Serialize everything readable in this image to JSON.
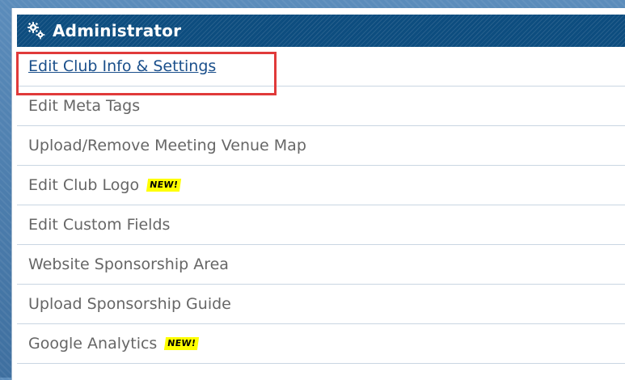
{
  "panel": {
    "title": "Administrator",
    "icon": "gears-icon"
  },
  "menu": {
    "items": [
      {
        "label": "Edit Club Info & Settings",
        "active": true
      },
      {
        "label": "Edit Meta Tags"
      },
      {
        "label": "Upload/Remove Meeting Venue Map"
      },
      {
        "label": "Edit Club Logo",
        "badge": "NEW!"
      },
      {
        "label": "Edit Custom Fields"
      },
      {
        "label": "Website Sponsorship Area"
      },
      {
        "label": "Upload Sponsorship Guide"
      },
      {
        "label": "Google Analytics",
        "badge": "NEW!"
      }
    ]
  },
  "colors": {
    "header_bg": "#0d4d7f",
    "link_active": "#1a4f8b",
    "highlight_border": "#e03a3a",
    "badge_bg": "#ffff00"
  }
}
